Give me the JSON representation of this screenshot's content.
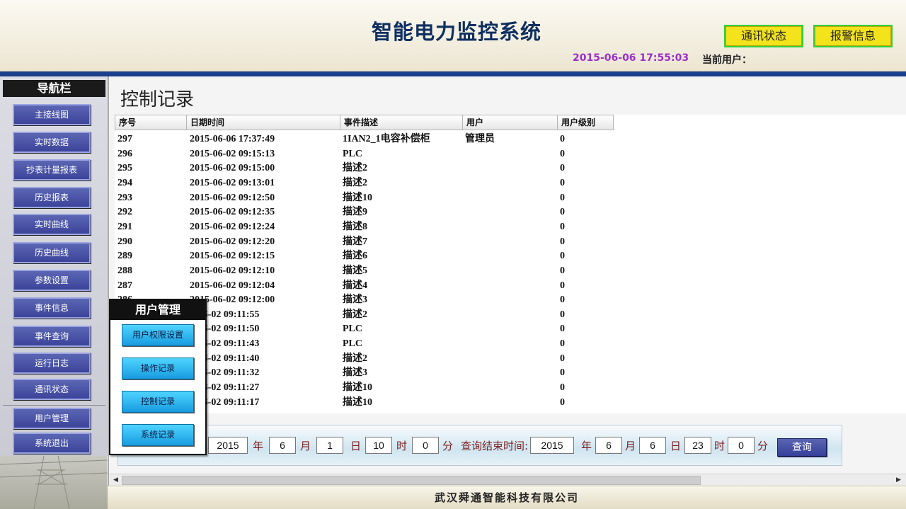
{
  "header": {
    "title": "智能电力监控系统",
    "comm_status_label": "通讯状态",
    "alarm_info_label": "报警信息",
    "datetime": "2015-06-06 17:55:03",
    "current_user_label": "当前用户："
  },
  "sidebar": {
    "title": "导航栏",
    "items": [
      "主接线图",
      "实时数据",
      "抄表计量报表",
      "历史报表",
      "实时曲线",
      "历史曲线",
      "参数设置",
      "事件信息",
      "事件查询",
      "运行日志",
      "通讯状态"
    ],
    "bottom_items": [
      "用户管理",
      "系统退出"
    ]
  },
  "main": {
    "page_title": "控制记录",
    "table": {
      "columns": [
        "序号",
        "日期时间",
        "事件描述",
        "用户",
        "用户级别"
      ],
      "rows": [
        [
          "297",
          "2015-06-06 17:37:49",
          "1IAN2_1电容补偿柜",
          "管理员",
          "0"
        ],
        [
          "296",
          "2015-06-02 09:15:13",
          "PLC",
          "",
          "0"
        ],
        [
          "295",
          "2015-06-02 09:15:00",
          "描述2",
          "",
          "0"
        ],
        [
          "294",
          "2015-06-02 09:13:01",
          "描述2",
          "",
          "0"
        ],
        [
          "293",
          "2015-06-02 09:12:50",
          "描述10",
          "",
          "0"
        ],
        [
          "292",
          "2015-06-02 09:12:35",
          "描述9",
          "",
          "0"
        ],
        [
          "291",
          "2015-06-02 09:12:24",
          "描述8",
          "",
          "0"
        ],
        [
          "290",
          "2015-06-02 09:12:20",
          "描述7",
          "",
          "0"
        ],
        [
          "289",
          "2015-06-02 09:12:15",
          "描述6",
          "",
          "0"
        ],
        [
          "288",
          "2015-06-02 09:12:10",
          "描述5",
          "",
          "0"
        ],
        [
          "287",
          "2015-06-02 09:12:04",
          "描述4",
          "",
          "0"
        ],
        [
          "286",
          "2015-06-02 09:12:00",
          "描述3",
          "",
          "0"
        ],
        [
          "",
          "5-06-02 09:11:55",
          "描述2",
          "",
          "0"
        ],
        [
          "",
          "5-06-02 09:11:50",
          "PLC",
          "",
          "0"
        ],
        [
          "",
          "5-06-02 09:11:43",
          "PLC",
          "",
          "0"
        ],
        [
          "",
          "5-06-02 09:11:40",
          "描述2",
          "",
          "0"
        ],
        [
          "",
          "5-06-02 09:11:32",
          "描述3",
          "",
          "0"
        ],
        [
          "",
          "5-06-02 09:11:27",
          "描述10",
          "",
          "0"
        ],
        [
          "",
          "5-06-02 09:11:17",
          "描述10",
          "",
          "0"
        ]
      ]
    },
    "query": {
      "start_year": "2015",
      "year_label": "年",
      "start_month": "6",
      "month_label": "月",
      "start_day": "1",
      "day_label": "日",
      "start_hour": "10",
      "hour_label": "时",
      "start_minute": "0",
      "minute_label": "分",
      "end_label": "查询结束时间:",
      "end_year": "2015",
      "end_month": "6",
      "end_day": "6",
      "end_hour": "23",
      "end_minute": "0",
      "button_label": "查询"
    }
  },
  "popup": {
    "title": "用户管理",
    "items": [
      "用户权限设置",
      "操作记录",
      "控制记录",
      "系统记录"
    ]
  },
  "footer": {
    "company": "武汉舜通智能科技有限公司"
  },
  "colors": {
    "nav_button": "#3c449a",
    "header_button": "#f2e31a",
    "datetime": "#9b2fc9",
    "header_bar": "#1b3f8c"
  }
}
